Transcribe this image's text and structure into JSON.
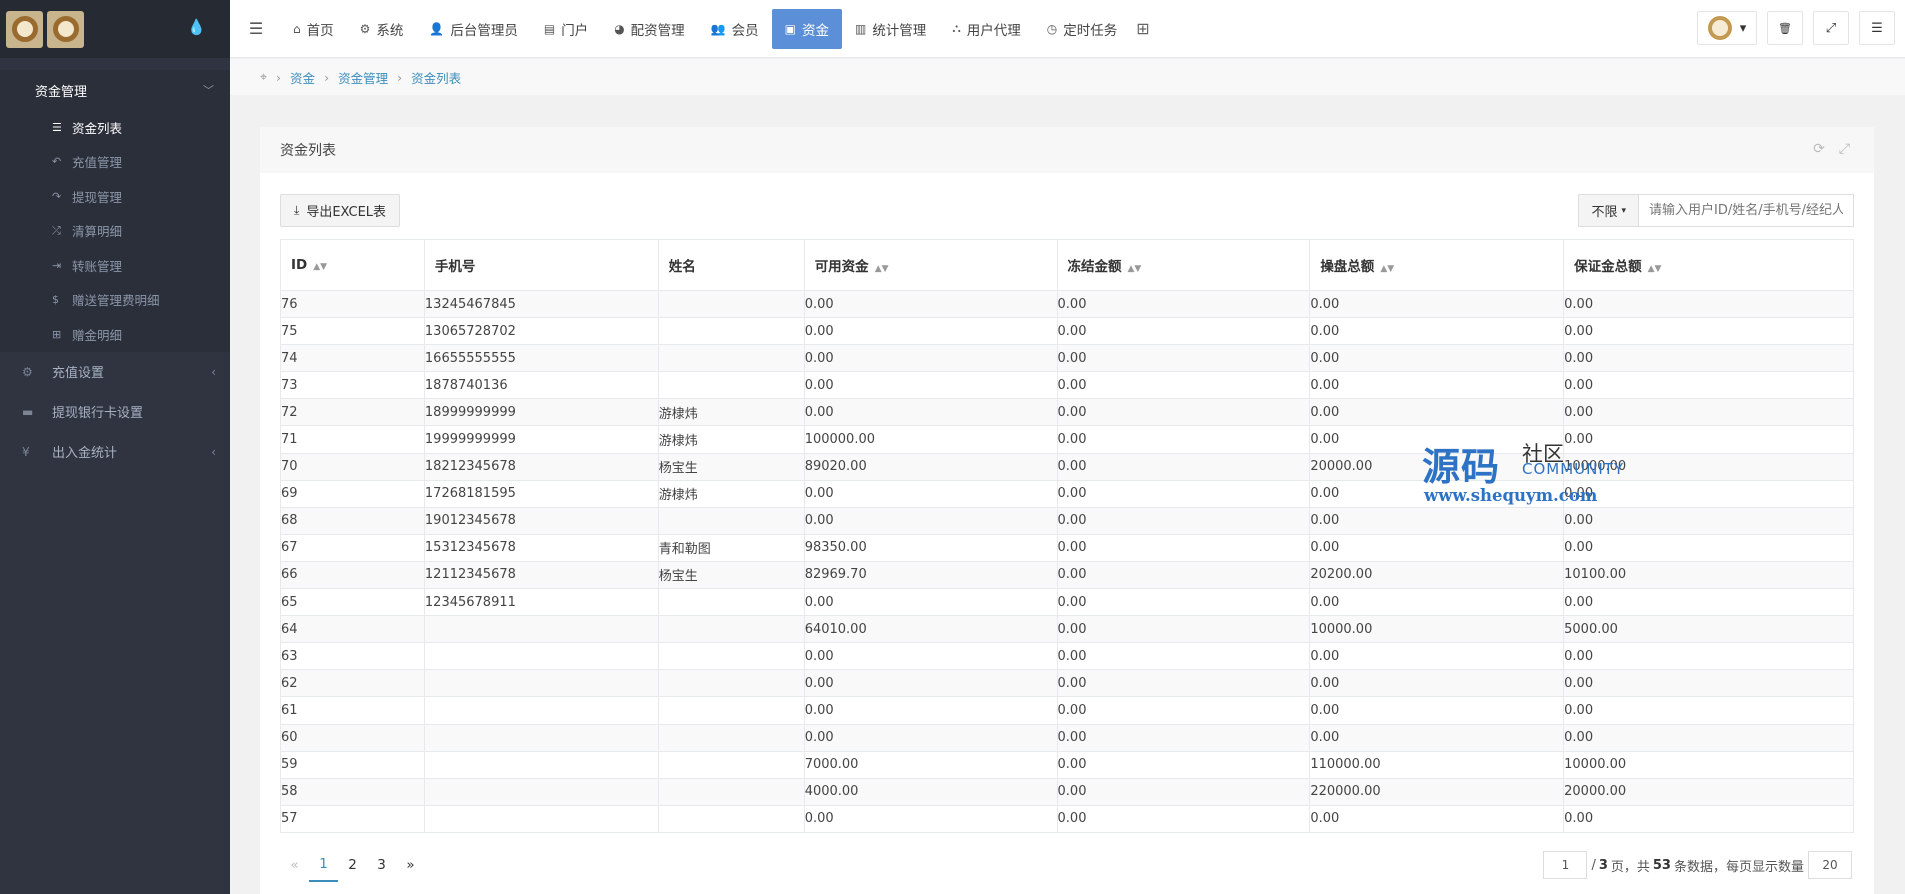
{
  "sidebar": {
    "toggle_icon": "droplet-icon",
    "group": {
      "label": "资金管理",
      "caret": "﹀"
    },
    "sub_items": [
      {
        "label": "资金列表",
        "icon": "☰",
        "active": true
      },
      {
        "label": "充值管理",
        "icon": "↶"
      },
      {
        "label": "提现管理",
        "icon": "↷"
      },
      {
        "label": "清算明细",
        "icon": "⤮"
      },
      {
        "label": "转账管理",
        "icon": "⇥"
      },
      {
        "label": "赠送管理费明细",
        "icon": "$"
      },
      {
        "label": "赠金明细",
        "icon": "⊞"
      }
    ],
    "top_items": [
      {
        "label": "充值设置",
        "icon": "⚙",
        "caret": "‹"
      },
      {
        "label": "提现银行卡设置",
        "icon": "▬",
        "caret": ""
      },
      {
        "label": "出入金统计",
        "icon": "¥",
        "caret": "‹"
      }
    ]
  },
  "nav": {
    "items": [
      {
        "label": "首页",
        "icon": "⌂"
      },
      {
        "label": "系统",
        "icon": "⚙"
      },
      {
        "label": "后台管理员",
        "icon": "👤"
      },
      {
        "label": "门户",
        "icon": "▤"
      },
      {
        "label": "配资管理",
        "icon": "◕"
      },
      {
        "label": "会员",
        "icon": "👥"
      },
      {
        "label": "资金",
        "icon": "▣",
        "active": true
      },
      {
        "label": "统计管理",
        "icon": "▥"
      },
      {
        "label": "用户代理",
        "icon": "⛬"
      },
      {
        "label": "定时任务",
        "icon": "◷"
      }
    ],
    "right_icons": {
      "caret": "▾",
      "trash": "🗑",
      "edit": "⤢",
      "menu": "☰"
    }
  },
  "breadcrumb": {
    "items": [
      "资金",
      "资金管理",
      "资金列表"
    ]
  },
  "panel": {
    "title": "资金列表",
    "export_label": "导出EXCEL表",
    "filter_label": "不限",
    "search_placeholder": "请输入用户ID/姓名/手机号/经纪人"
  },
  "table": {
    "columns": [
      "ID",
      "手机号",
      "姓名",
      "可用资金",
      "冻结金额",
      "操盘总额",
      "保证金总额"
    ],
    "rows": [
      [
        "76",
        "13245467845",
        "",
        "0.00",
        "0.00",
        "0.00",
        "0.00"
      ],
      [
        "75",
        "13065728702",
        "",
        "0.00",
        "0.00",
        "0.00",
        "0.00"
      ],
      [
        "74",
        "16655555555",
        "",
        "0.00",
        "0.00",
        "0.00",
        "0.00"
      ],
      [
        "73",
        "1878740136",
        "",
        "0.00",
        "0.00",
        "0.00",
        "0.00"
      ],
      [
        "72",
        "18999999999",
        "游棣炜",
        "0.00",
        "0.00",
        "0.00",
        "0.00"
      ],
      [
        "71",
        "19999999999",
        "游棣炜",
        "100000.00",
        "0.00",
        "0.00",
        "0.00"
      ],
      [
        "70",
        "18212345678",
        "杨宝生",
        "89020.00",
        "0.00",
        "20000.00",
        "10000.00"
      ],
      [
        "69",
        "17268181595",
        "游棣炜",
        "0.00",
        "0.00",
        "0.00",
        "0.00"
      ],
      [
        "68",
        "19012345678",
        "",
        "0.00",
        "0.00",
        "0.00",
        "0.00"
      ],
      [
        "67",
        "15312345678",
        "青和勒图",
        "98350.00",
        "0.00",
        "0.00",
        "0.00"
      ],
      [
        "66",
        "12112345678",
        "杨宝生",
        "82969.70",
        "0.00",
        "20200.00",
        "10100.00"
      ],
      [
        "65",
        "12345678911",
        "",
        "0.00",
        "0.00",
        "0.00",
        "0.00"
      ],
      [
        "64",
        "",
        "",
        "64010.00",
        "0.00",
        "10000.00",
        "5000.00"
      ],
      [
        "63",
        "",
        "",
        "0.00",
        "0.00",
        "0.00",
        "0.00"
      ],
      [
        "62",
        "",
        "",
        "0.00",
        "0.00",
        "0.00",
        "0.00"
      ],
      [
        "61",
        "",
        "",
        "0.00",
        "0.00",
        "0.00",
        "0.00"
      ],
      [
        "60",
        "",
        "",
        "0.00",
        "0.00",
        "0.00",
        "0.00"
      ],
      [
        "59",
        "",
        "",
        "7000.00",
        "0.00",
        "110000.00",
        "10000.00"
      ],
      [
        "58",
        "",
        "",
        "4000.00",
        "0.00",
        "220000.00",
        "20000.00"
      ],
      [
        "57",
        "",
        "",
        "0.00",
        "0.00",
        "0.00",
        "0.00"
      ]
    ]
  },
  "pagination": {
    "prev": "«",
    "pages": [
      "1",
      "2",
      "3"
    ],
    "current": "1",
    "next": "»",
    "page_input": "1",
    "total_pages_text": "/ ",
    "total_pages": "3",
    "mid_text": " 页，共 ",
    "total_records": "53",
    "tail_text": " 条数据，每页显示数量",
    "per_page": "20"
  },
  "watermark": {
    "big": "源码",
    "small": "社区",
    "english": "COMMUNITY",
    "url": "www.shequym.com"
  }
}
